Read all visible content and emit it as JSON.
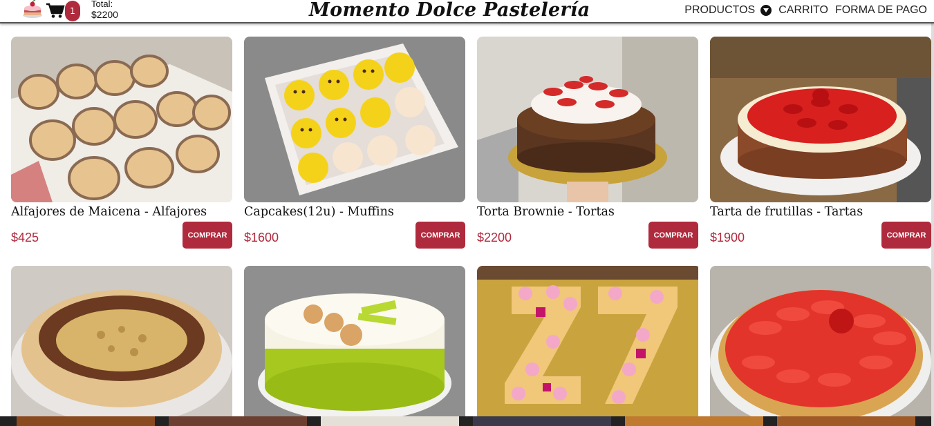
{
  "header": {
    "cart_count": "1",
    "total_label": "Total:",
    "total_value": "$2200",
    "brand": "Momento Dolce Pastelería",
    "nav": {
      "productos": "PRODUCTOS",
      "carrito": "CARRITO",
      "forma_de_pago": "FORMA DE PAGO"
    }
  },
  "products": [
    {
      "title": "Alfajores de Maicena - Alfajores",
      "price": "$425",
      "buy_label": "COMPRAR",
      "image": "alfajores-photo"
    },
    {
      "title": "Capcakes(12u) - Muffins",
      "price": "$1600",
      "buy_label": "COMPRAR",
      "image": "cupcakes-photo"
    },
    {
      "title": "Torta Brownie - Tortas",
      "price": "$2200",
      "buy_label": "COMPRAR",
      "image": "brownie-cake-photo"
    },
    {
      "title": "Tarta de frutillas - Tartas",
      "price": "$1900",
      "buy_label": "COMPRAR",
      "image": "strawberry-tart-photo"
    },
    {
      "image": "crumble-tart-photo"
    },
    {
      "image": "lemon-mousse-cake-photo"
    },
    {
      "image": "number-cake-photo"
    },
    {
      "image": "strawberry-pie-photo"
    }
  ],
  "colors": {
    "accent": "#b02a3d",
    "text": "#111111"
  },
  "icons": {
    "logo": "cake-slice-icon",
    "cart": "shopping-cart-icon",
    "dropdown": "chevron-down-circle-icon"
  }
}
